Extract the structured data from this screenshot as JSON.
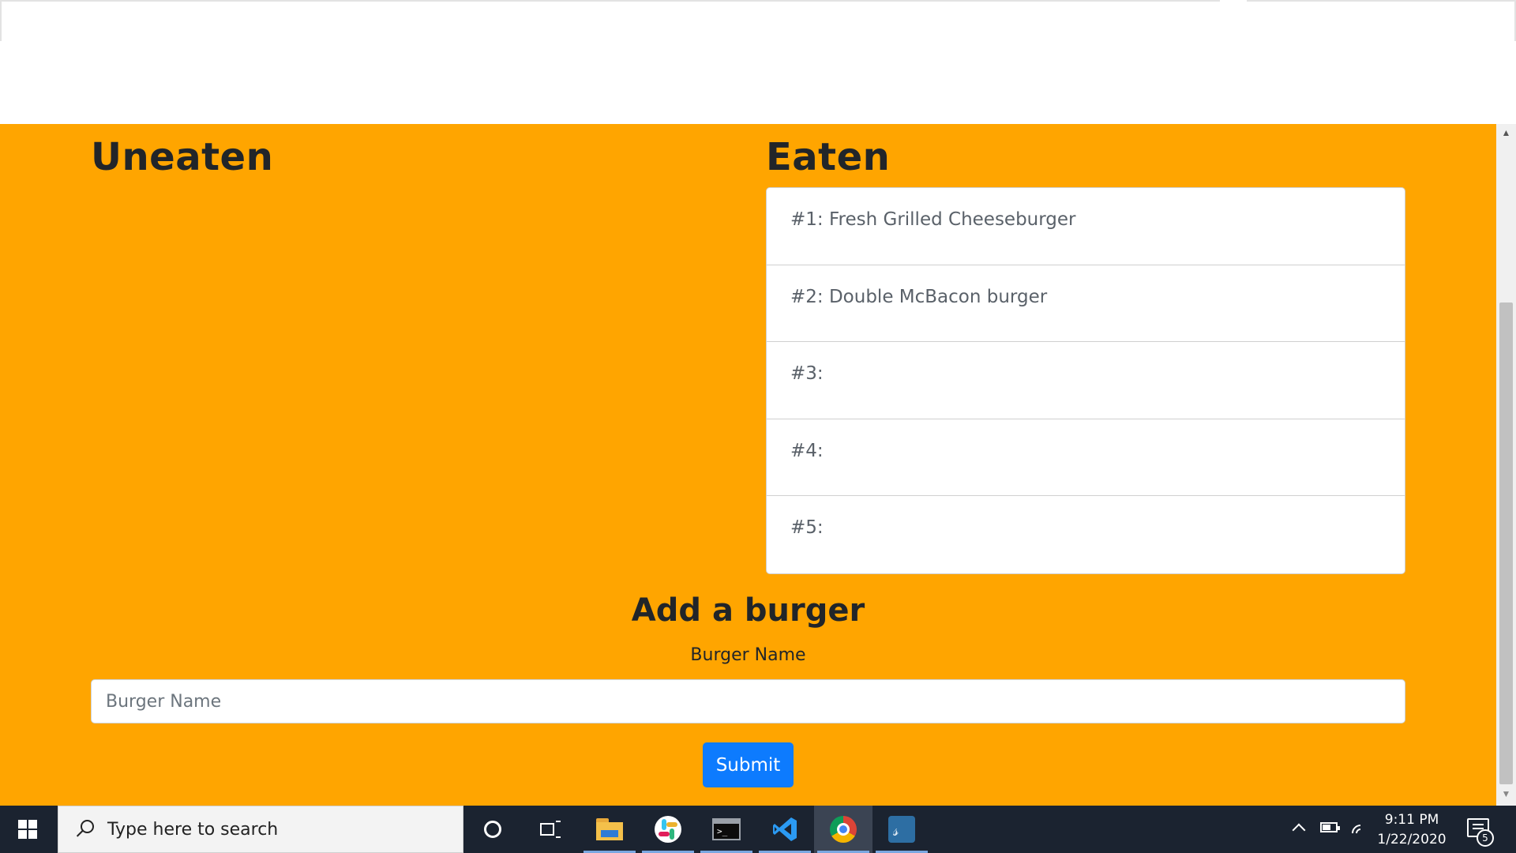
{
  "uneaten": {
    "title": "Uneaten"
  },
  "eaten": {
    "title": "Eaten",
    "items": [
      {
        "label": "#1: Fresh Grilled Cheeseburger"
      },
      {
        "label": "#2: Double McBacon burger"
      },
      {
        "label": "#3:"
      },
      {
        "label": "#4:"
      },
      {
        "label": "#5:"
      }
    ]
  },
  "form": {
    "title": "Add a burger",
    "label": "Burger Name",
    "input_placeholder": "Burger Name",
    "input_value": "",
    "submit_label": "Submit"
  },
  "colors": {
    "page_background": "#FFA500",
    "submit_button": "#0d7bfe",
    "taskbar": "#1b2330"
  },
  "taskbar": {
    "search_placeholder": "Type here to search",
    "apps": [
      {
        "icon": "cortana-icon"
      },
      {
        "icon": "task-view-icon"
      },
      {
        "icon": "file-explorer-icon"
      },
      {
        "icon": "slack-icon"
      },
      {
        "icon": "terminal-icon"
      },
      {
        "icon": "vscode-icon"
      },
      {
        "icon": "chrome-icon",
        "active": true
      },
      {
        "icon": "mysql-workbench-icon"
      }
    ],
    "time": "9:11 PM",
    "date": "1/22/2020",
    "notification_count": "5"
  }
}
